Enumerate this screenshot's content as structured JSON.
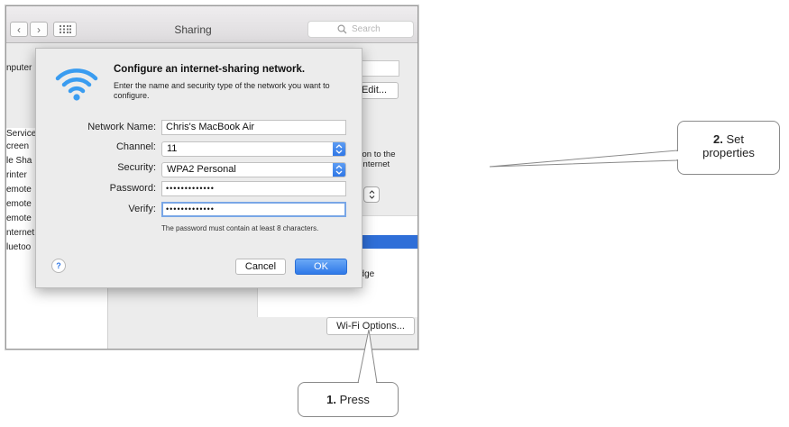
{
  "window": {
    "title": "Sharing",
    "search_placeholder": "Search",
    "back_glyph": "‹",
    "forward_glyph": "›"
  },
  "background": {
    "computer_name_label_fragment": "nputer",
    "edit_button": "Edit...",
    "services": [
      "Service",
      "creen",
      "le Sha",
      "rinter",
      "emote",
      "emote",
      "emote",
      "nternet",
      "luetoo"
    ],
    "detail_text": [
      "ction to the",
      "e Internet"
    ],
    "bridge_text": "ridge",
    "wifi_options_button": "Wi-Fi Options..."
  },
  "dialog": {
    "title": "Configure an internet-sharing network.",
    "description": "Enter the name and security type of the network you want to configure.",
    "fields": {
      "network_name_label": "Network Name:",
      "network_name_value": "Chris's MacBook Air",
      "channel_label": "Channel:",
      "channel_value": "11",
      "security_label": "Security:",
      "security_value": "WPA2 Personal",
      "password_label": "Password:",
      "password_value": "•••••••••••••",
      "verify_label": "Verify:",
      "verify_value": "•••••••••••••"
    },
    "hint": "The password must contain at least 8 characters.",
    "help": "?",
    "cancel": "Cancel",
    "ok": "OK"
  },
  "callouts": {
    "step1_number": "1.",
    "step1_text": " Press",
    "step2_number": "2.",
    "step2_text_a": " Set",
    "step2_text_b": "properties"
  },
  "icons": [
    "wifi-icon",
    "grid-icon",
    "search-icon",
    "chevron-updown-icon",
    "help-icon"
  ],
  "colors": {
    "accent": "#2f77e6",
    "wifi_logo": "#3a9cf0",
    "selection": "#2f6fd8"
  }
}
